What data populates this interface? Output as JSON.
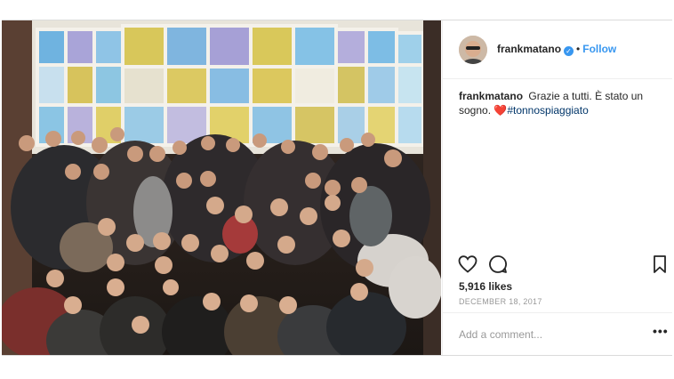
{
  "post": {
    "username": "frankmatano",
    "verified_icon": "verified-badge-icon",
    "follow_separator": "•",
    "follow_label": "Follow",
    "caption_username": "frankmatano",
    "caption_text": "Grazie a tutti. È stato un sogno.",
    "caption_emoji": "❤️",
    "caption_hashtag": "#tonnospiaggiato",
    "likes": "5,916 likes",
    "date": "DECEMBER 18, 2017",
    "comment_placeholder": "Add a comment...",
    "more_label": "•••"
  },
  "colors": {
    "link_blue": "#3897f0",
    "hashtag_blue": "#003569",
    "meta_gray": "#999999",
    "border": "#efefef",
    "text": "#262626"
  },
  "icons": [
    "heart-icon",
    "comment-icon",
    "bookmark-icon",
    "more-options-icon",
    "verified-badge-icon"
  ]
}
